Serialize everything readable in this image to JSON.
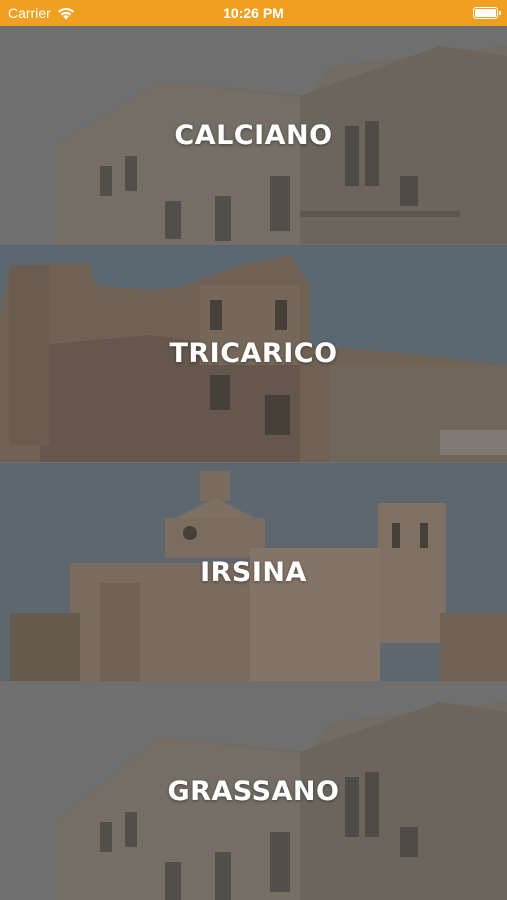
{
  "status_bar": {
    "carrier": "Carrier",
    "time": "10:26 PM",
    "battery_level": 1.0,
    "background_color": "#F0A020"
  },
  "towns": [
    {
      "name": "CALCIANO"
    },
    {
      "name": "TRICARICO"
    },
    {
      "name": "IRSINA"
    },
    {
      "name": "GRASSANO"
    }
  ]
}
